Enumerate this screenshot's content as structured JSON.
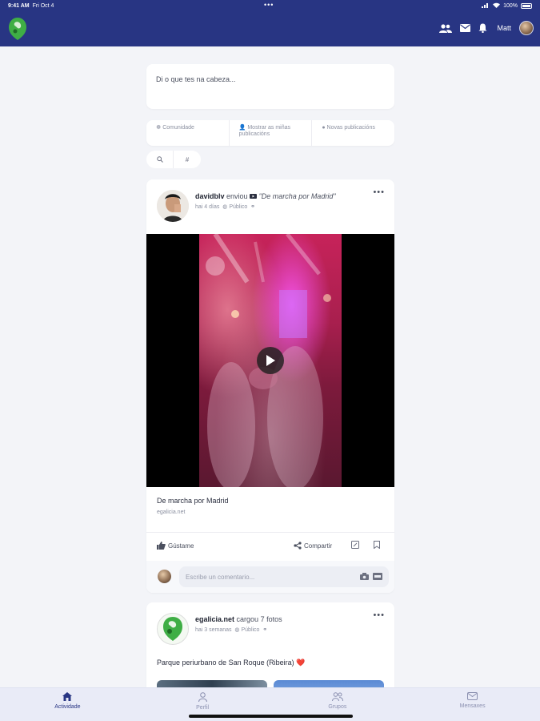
{
  "status_bar": {
    "time": "9:41 AM",
    "date": "Fri Oct 4",
    "battery": "100%"
  },
  "header": {
    "user_name": "Matt",
    "icons": [
      "users-icon",
      "mail-icon",
      "bell-icon"
    ],
    "brand_color": "#283583"
  },
  "composer": {
    "placeholder": "Di o que tes na cabeza..."
  },
  "filters": [
    {
      "icon": "community-icon",
      "label": "Comunidade"
    },
    {
      "icon": "user-icon",
      "label": "Mostrar as miñas publicacións"
    },
    {
      "icon": "chat-icon",
      "label": "Novas publicacións"
    }
  ],
  "chips": [
    {
      "icon": "search-icon"
    },
    {
      "label": "#"
    }
  ],
  "post1": {
    "author": "davidblv",
    "verb": "enviou",
    "title": "\"De marcha por Madrid\"",
    "time": "hai 4 días",
    "visibility": "Público",
    "caption": "De marcha por Madrid",
    "domain": "egalicia.net",
    "actions": {
      "like": "Gústame",
      "share": "Compartir"
    },
    "comment_placeholder": "Escribe un comentario..."
  },
  "post2": {
    "author": "egalicia.net",
    "verb": "cargou 7 fotos",
    "time": "hai 3 semanas",
    "visibility": "Público",
    "text": "Parque periurbano de San Roque (Ribeira)",
    "emoji": "❤️"
  },
  "tabs": [
    {
      "label": "Actividade",
      "icon": "home-icon",
      "active": true
    },
    {
      "label": "Perfil",
      "icon": "profile-icon",
      "active": false
    },
    {
      "label": "Grupos",
      "icon": "groups-icon",
      "active": false
    },
    {
      "label": "Mensaxes",
      "icon": "messages-icon",
      "active": false
    }
  ]
}
